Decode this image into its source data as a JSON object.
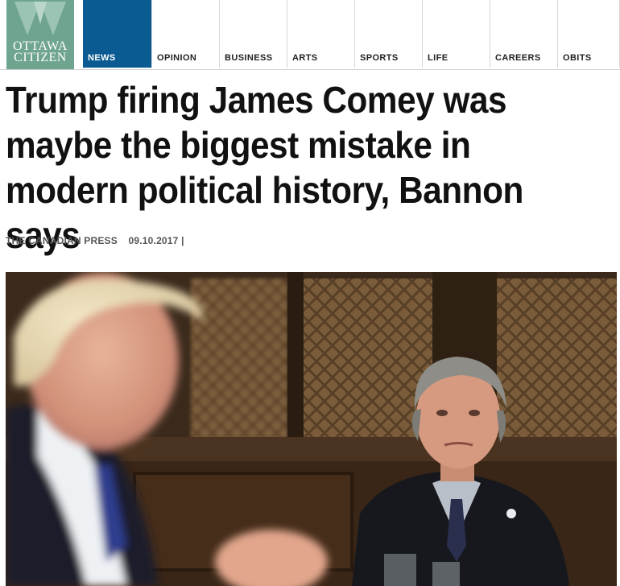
{
  "site": {
    "logo_line1": "OTTAWA",
    "logo_line2": "CITIZEN",
    "logo_color": "#6fa48f",
    "accent_color": "#0b5b93"
  },
  "nav": {
    "items": [
      {
        "label": "NEWS",
        "active": true
      },
      {
        "label": "OPINION"
      },
      {
        "label": "BUSINESS"
      },
      {
        "label": "ARTS"
      },
      {
        "label": "SPORTS"
      },
      {
        "label": "LIFE"
      },
      {
        "label": "CAREERS"
      },
      {
        "label": "OBITS"
      }
    ]
  },
  "article": {
    "headline": "Trump firing James Comey was maybe the biggest mistake in modern political history, Bannon says",
    "source": "THE CANADIAN PRESS",
    "date": "09.10.2017 |"
  }
}
